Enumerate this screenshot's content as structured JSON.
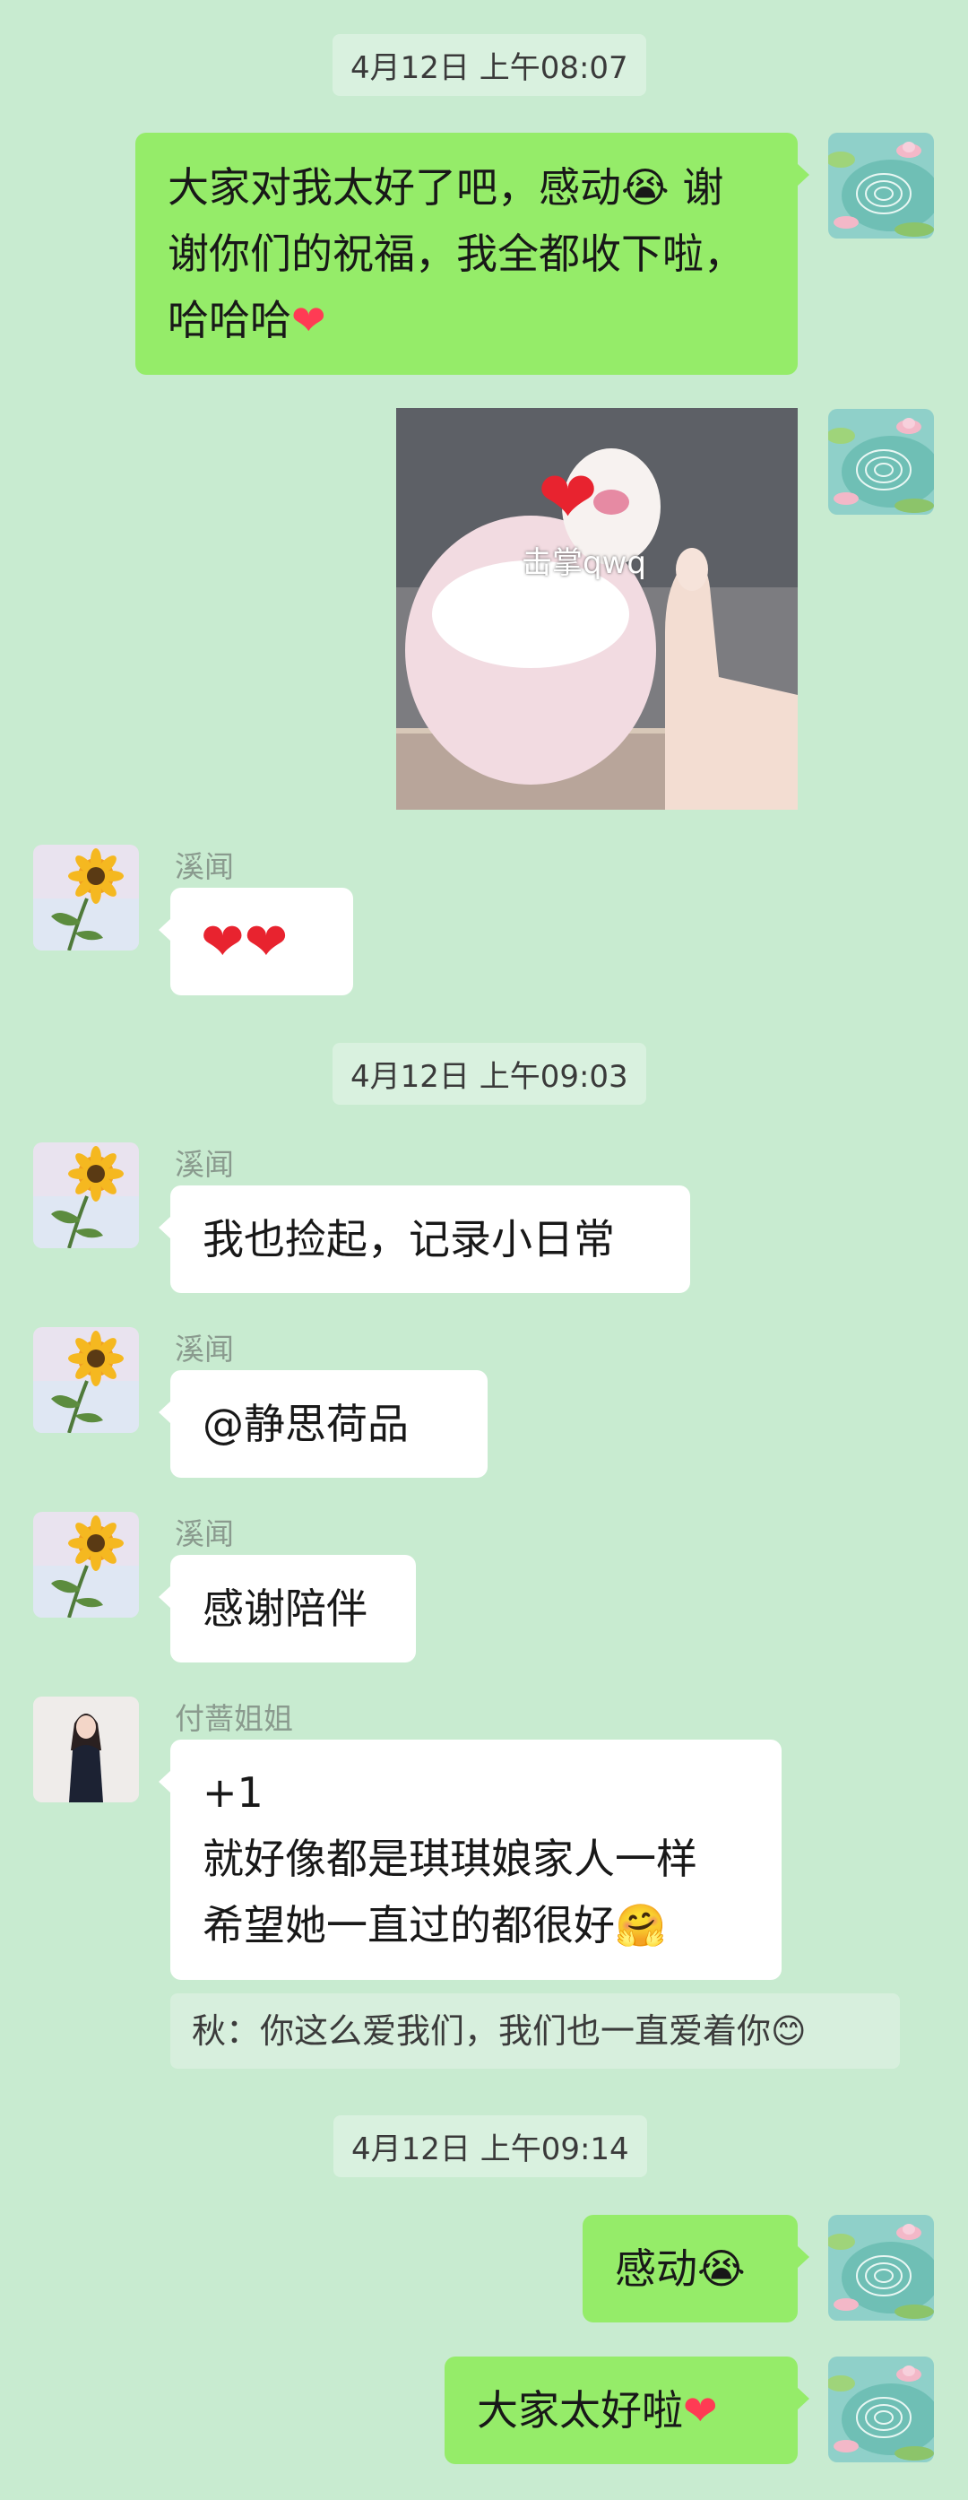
{
  "timestamps": [
    "4月12日 上午08:07",
    "4月12日 上午09:03",
    "4月12日 上午09:14"
  ],
  "messages": {
    "m1": {
      "lines": [
        "大家对我太好了吧，感动",
        "谢",
        "谢你们的祝福，我全都收下啦，",
        "哈哈哈"
      ],
      "emoji_cry": "😭",
      "emoji_heart": "❤"
    },
    "m2": {
      "sticker_caption": "击掌qwq",
      "sticker_heart": "❤"
    },
    "m3": {
      "sender": "溪闻",
      "hearts": "❤❤"
    },
    "m4": {
      "sender": "溪闻",
      "text": "我也捡起，记录小日常"
    },
    "m5": {
      "sender": "溪闻",
      "text": "@静思荷品"
    },
    "m6": {
      "sender": "溪闻",
      "text": "感谢陪伴"
    },
    "m7": {
      "sender": "付蔷姐姐",
      "lines": [
        "+1",
        "就好像都是琪琪娘家人一样",
        "希望她一直过的都很好"
      ],
      "emoji_hug": "🤗",
      "quote": "秋：你这么爱我们，我们也一直爱着你",
      "quote_emoji": "😊"
    },
    "m8": {
      "text": "感动",
      "emoji_cry": "😭"
    },
    "m9": {
      "text": "大家太好啦",
      "emoji_heart": "❤"
    }
  },
  "icons": {
    "self_avatar": "lotus-pond-avatar",
    "xiwen_avatar": "sunflower-avatar",
    "fuqiang_avatar": "woman-portrait-avatar"
  },
  "colors": {
    "background": "#c8ebd0",
    "outgoing_bubble": "#95ec69",
    "incoming_bubble": "#ffffff",
    "timestamp_bg": "#d9f1df"
  }
}
